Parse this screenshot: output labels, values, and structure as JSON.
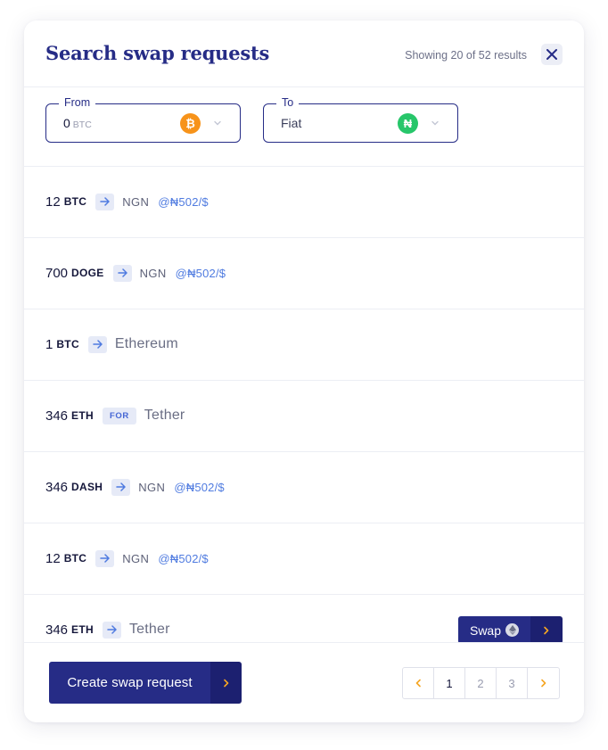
{
  "header": {
    "title": "Search swap requests",
    "result_count": "Showing 20 of 52 results",
    "close_icon": "close-icon"
  },
  "filters": {
    "from": {
      "label": "From",
      "value": "0",
      "unit": "BTC",
      "coin_icon": "bitcoin-icon",
      "coin_glyph": "₿",
      "coin_color": "#f7931a"
    },
    "to": {
      "label": "To",
      "value": "Fiat",
      "coin_icon": "naira-icon",
      "coin_glyph": "₦",
      "coin_color": "#27c66a"
    }
  },
  "rows": [
    {
      "amount": "12",
      "symbol": "BTC",
      "connector": "arrow",
      "target": "NGN",
      "rate": "@₦502/$"
    },
    {
      "amount": "700",
      "symbol": "DOGE",
      "connector": "arrow",
      "target": "NGN",
      "rate": "@₦502/$"
    },
    {
      "amount": "1",
      "symbol": "BTC",
      "connector": "arrow",
      "target": "Ethereum",
      "rate": ""
    },
    {
      "amount": "346",
      "symbol": "ETH",
      "connector": "for",
      "connector_label": "FOR",
      "target": "Tether",
      "rate": ""
    },
    {
      "amount": "346",
      "symbol": "DASH",
      "connector": "arrow",
      "target": "NGN",
      "rate": "@₦502/$"
    },
    {
      "amount": "12",
      "symbol": "BTC",
      "connector": "arrow",
      "target": "NGN",
      "rate": "@₦502/$"
    },
    {
      "amount": "346",
      "symbol": "ETH",
      "connector": "arrow",
      "target": "Tether",
      "rate": ""
    }
  ],
  "swap_button": {
    "label": "Swap",
    "icon": "ethereum-icon"
  },
  "footer": {
    "create_label": "Create swap request",
    "pages": [
      "1",
      "2",
      "3"
    ],
    "current_page": "1"
  },
  "colors": {
    "primary": "#262c86",
    "primary_dark": "#1c2070",
    "accent_orange": "#f5a623",
    "rate_blue": "#4f7be0"
  }
}
